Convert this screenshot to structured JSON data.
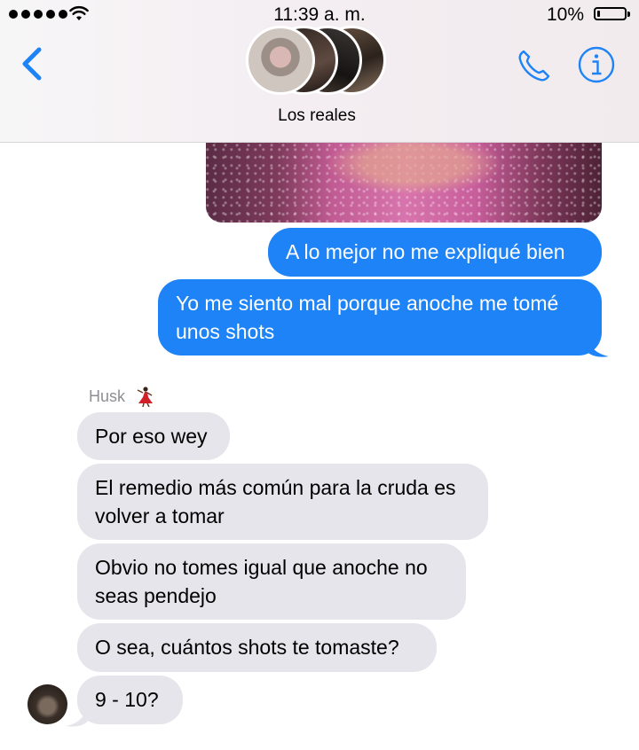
{
  "status_bar": {
    "time": "11:39 a. m.",
    "battery_percent_label": "10%",
    "battery_level": 0.1
  },
  "header": {
    "group_name": "Los reales",
    "icons": {
      "back": "chevron-left-icon",
      "call": "phone-icon",
      "info": "info-icon"
    },
    "accent_color": "#1d83f6"
  },
  "messages": {
    "outgoing": [
      "A lo mejor no me expliqué bien",
      "Yo me siento mal porque anoche me tomé unos shots"
    ],
    "sender_name": "Husk",
    "sender_emoji": "💃",
    "incoming": [
      "Por eso wey",
      "El remedio más común para la cruda es volver a tomar",
      "Obvio no tomes igual que anoche no seas pendejo",
      "O sea, cuántos shots te tomaste?",
      "9 - 10?"
    ]
  },
  "colors": {
    "outgoing_bubble": "#1d83f6",
    "incoming_bubble": "#e6e5eb",
    "sender_label": "#8e8e93"
  }
}
